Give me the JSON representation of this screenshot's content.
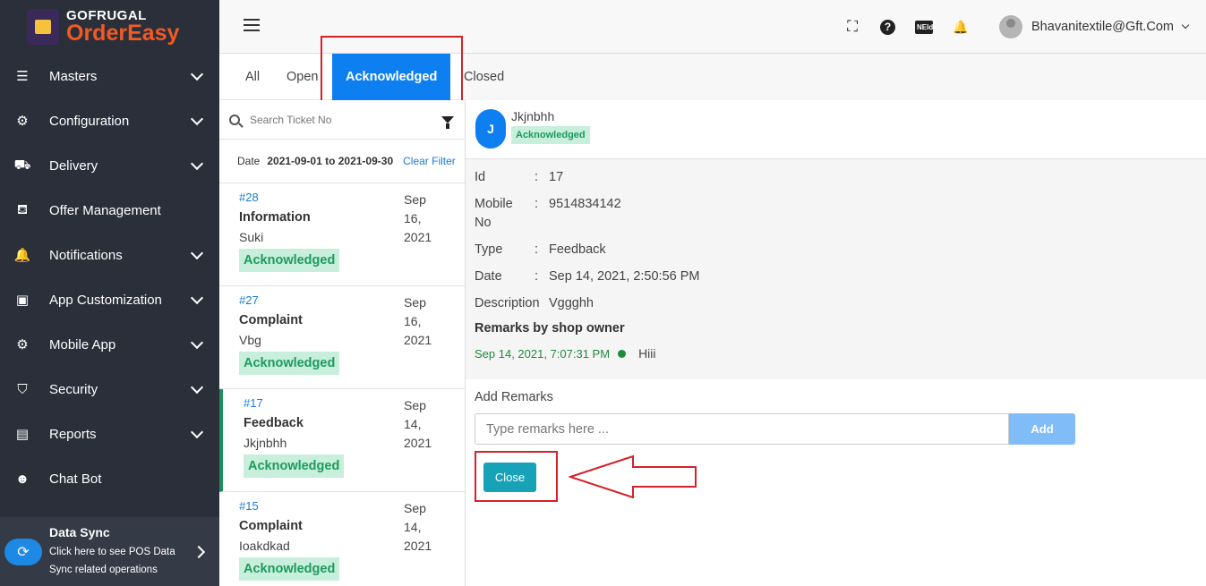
{
  "brand": {
    "top": "GOFRUGAL",
    "bottom": "OrderEasy"
  },
  "sidebar": {
    "items": [
      {
        "label": "Masters",
        "icon": "list-icon",
        "glyph": "☰",
        "has_chevron": true
      },
      {
        "label": "Configuration",
        "icon": "gear-icon",
        "glyph": "⚙",
        "has_chevron": true
      },
      {
        "label": "Delivery",
        "icon": "delivery-icon",
        "glyph": "⛟",
        "has_chevron": true
      },
      {
        "label": "Offer Management",
        "icon": "basket-icon",
        "glyph": "⛾",
        "has_chevron": false
      },
      {
        "label": "Notifications",
        "icon": "bell-icon",
        "glyph": "🔔",
        "has_chevron": true
      },
      {
        "label": "App Customization",
        "icon": "app-icon",
        "glyph": "▣",
        "has_chevron": true
      },
      {
        "label": "Mobile App",
        "icon": "gear-icon",
        "glyph": "⚙",
        "has_chevron": true
      },
      {
        "label": "Security",
        "icon": "shield-icon",
        "glyph": "⛉",
        "has_chevron": true
      },
      {
        "label": "Reports",
        "icon": "report-icon",
        "glyph": "▤",
        "has_chevron": true
      },
      {
        "label": "Chat Bot",
        "icon": "robot-icon",
        "glyph": "☻",
        "has_chevron": false
      }
    ],
    "data_sync": {
      "title": "Data Sync",
      "line1": "Click here to see POS Data",
      "line2": "Sync related operations"
    }
  },
  "header": {
    "user": "Bhavanitextile@Gft.Com",
    "nelu_label": "NEld"
  },
  "tabs": [
    {
      "label": "All"
    },
    {
      "label": "Open"
    },
    {
      "label": "Acknowledged"
    },
    {
      "label": "Closed"
    }
  ],
  "list": {
    "search_placeholder": "Search Ticket No",
    "date_label": "Date",
    "date_range": "2021-09-01 to 2021-09-30",
    "clear_filter": "Clear Filter",
    "tickets": [
      {
        "id": "#28",
        "type": "Information",
        "name": "Suki",
        "status": "Acknowledged",
        "date1": "Sep 16,",
        "date2": "2021"
      },
      {
        "id": "#27",
        "type": "Complaint",
        "name": "Vbg",
        "status": "Acknowledged",
        "date1": "Sep 16,",
        "date2": "2021"
      },
      {
        "id": "#17",
        "type": "Feedback",
        "name": "Jkjnbhh",
        "status": "Acknowledged",
        "date1": "Sep 14,",
        "date2": "2021"
      },
      {
        "id": "#15",
        "type": "Complaint",
        "name": "Ioakdkad",
        "status": "Acknowledged",
        "date1": "Sep 14,",
        "date2": "2021"
      }
    ]
  },
  "detail": {
    "avatar_letter": "J",
    "name": "Jkjnbhh",
    "status": "Acknowledged",
    "fields": {
      "id_label": "Id",
      "id_value": "17",
      "mobile_label1": "Mobile",
      "mobile_label2": "No",
      "mobile_value": "9514834142",
      "type_label": "Type",
      "type_value": "Feedback",
      "date_label": "Date",
      "date_value": "Sep 14, 2021, 2:50:56 PM",
      "desc_label": "Description",
      "desc_value": "Vggghh",
      "colon": ":"
    },
    "remarks_title": "Remarks by shop owner",
    "remark": {
      "timestamp": "Sep 14, 2021, 7:07:31 PM",
      "text": "Hiii"
    },
    "add_remarks_label": "Add Remarks",
    "remarks_placeholder": "Type remarks here ...",
    "add_button": "Add",
    "close_button": "Close"
  }
}
